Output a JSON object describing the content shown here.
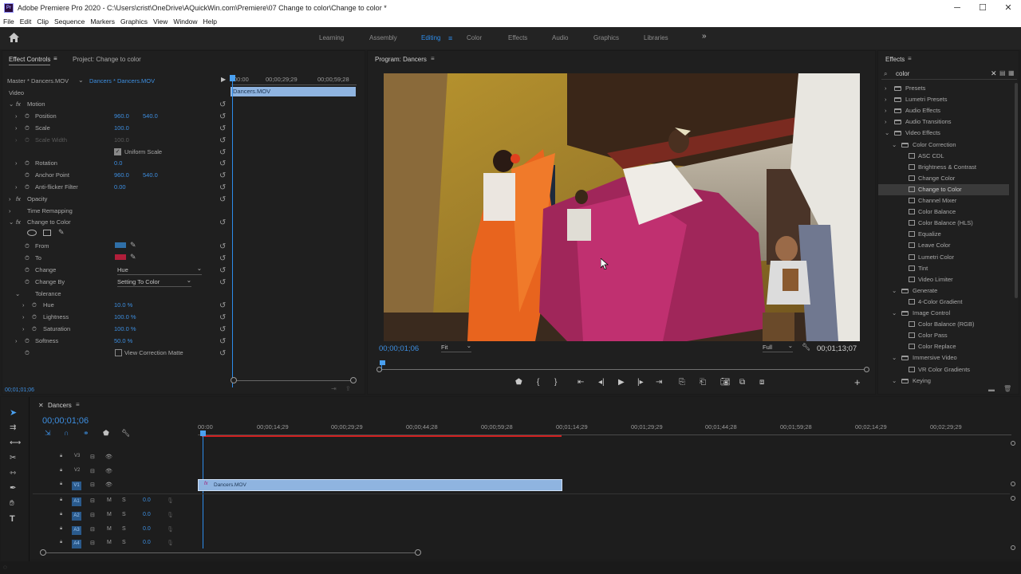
{
  "app": {
    "title": "Adobe Premiere Pro 2020 - C:\\Users\\crist\\OneDrive\\AQuickWin.com\\Premiere\\07 Change to color\\Change to color *"
  },
  "menu": [
    "File",
    "Edit",
    "Clip",
    "Sequence",
    "Markers",
    "Graphics",
    "View",
    "Window",
    "Help"
  ],
  "workspaces": [
    {
      "label": "Learning"
    },
    {
      "label": "Assembly"
    },
    {
      "label": "Editing",
      "active": true
    },
    {
      "label": "Color"
    },
    {
      "label": "Effects"
    },
    {
      "label": "Audio"
    },
    {
      "label": "Graphics"
    },
    {
      "label": "Libraries"
    }
  ],
  "effect_controls": {
    "tab_label": "Effect Controls",
    "project_tab": "Project: Change to color",
    "master": "Master * Dancers.MOV",
    "clip": "Dancers * Dancers.MOV",
    "ruler": [
      "00:00",
      "00;00;29;29",
      "00;00;59;28"
    ],
    "clip_bar": "Dancers.MOV",
    "timecode": "00;01;01;06",
    "video_label": "Video",
    "motion": "Motion",
    "position": {
      "label": "Position",
      "x": "960.0",
      "y": "540.0"
    },
    "scale": {
      "label": "Scale",
      "value": "100.0"
    },
    "scale_width": {
      "label": "Scale Width",
      "value": "100.0"
    },
    "uniform_scale": "Uniform Scale",
    "rotation": {
      "label": "Rotation",
      "value": "0.0"
    },
    "anchor": {
      "label": "Anchor Point",
      "x": "960.0",
      "y": "540.0"
    },
    "antiflicker": {
      "label": "Anti-flicker Filter",
      "value": "0.00"
    },
    "opacity": "Opacity",
    "time_remap": "Time Remapping",
    "change_to_color": "Change to Color",
    "from": "From",
    "to": "To",
    "change": {
      "label": "Change",
      "value": "Hue"
    },
    "change_by": {
      "label": "Change By",
      "value": "Setting To Color"
    },
    "tolerance": "Tolerance",
    "hue": {
      "label": "Hue",
      "value": "10.0 %"
    },
    "lightness": {
      "label": "Lightness",
      "value": "100.0 %"
    },
    "saturation": {
      "label": "Saturation",
      "value": "100.0 %"
    },
    "softness": {
      "label": "Softness",
      "value": "50.0 %"
    },
    "view_matte": "View Correction Matte",
    "from_color": "#2f6fa8",
    "to_color": "#b01e3a"
  },
  "program": {
    "title": "Program: Dancers",
    "timecode": "00;00;01;06",
    "fit": "Fit",
    "quality": "Full",
    "duration": "00;01;13;07"
  },
  "effects": {
    "title": "Effects",
    "search": "color",
    "items": [
      {
        "label": "Presets",
        "level": 0,
        "type": "folder"
      },
      {
        "label": "Lumetri Presets",
        "level": 0,
        "type": "folder"
      },
      {
        "label": "Audio Effects",
        "level": 0,
        "type": "folder"
      },
      {
        "label": "Audio Transitions",
        "level": 0,
        "type": "folder"
      },
      {
        "label": "Video Effects",
        "level": 0,
        "type": "folder",
        "open": true
      },
      {
        "label": "Color Correction",
        "level": 1,
        "type": "folder",
        "open": true
      },
      {
        "label": "ASC CDL",
        "level": 2,
        "type": "fx"
      },
      {
        "label": "Brightness & Contrast",
        "level": 2,
        "type": "fx"
      },
      {
        "label": "Change Color",
        "level": 2,
        "type": "fx"
      },
      {
        "label": "Change to Color",
        "level": 2,
        "type": "fx",
        "selected": true
      },
      {
        "label": "Channel Mixer",
        "level": 2,
        "type": "fx"
      },
      {
        "label": "Color Balance",
        "level": 2,
        "type": "fx"
      },
      {
        "label": "Color Balance (HLS)",
        "level": 2,
        "type": "fx"
      },
      {
        "label": "Equalize",
        "level": 2,
        "type": "fx"
      },
      {
        "label": "Leave Color",
        "level": 2,
        "type": "fx"
      },
      {
        "label": "Lumetri Color",
        "level": 2,
        "type": "fx"
      },
      {
        "label": "Tint",
        "level": 2,
        "type": "fx"
      },
      {
        "label": "Video Limiter",
        "level": 2,
        "type": "fx"
      },
      {
        "label": "Generate",
        "level": 1,
        "type": "folder",
        "open": true
      },
      {
        "label": "4-Color Gradient",
        "level": 2,
        "type": "fx"
      },
      {
        "label": "Image Control",
        "level": 1,
        "type": "folder",
        "open": true
      },
      {
        "label": "Color Balance (RGB)",
        "level": 2,
        "type": "fx"
      },
      {
        "label": "Color Pass",
        "level": 2,
        "type": "fx"
      },
      {
        "label": "Color Replace",
        "level": 2,
        "type": "fx"
      },
      {
        "label": "Immersive Video",
        "level": 1,
        "type": "folder",
        "open": true
      },
      {
        "label": "VR Color Gradients",
        "level": 2,
        "type": "fx"
      },
      {
        "label": "Keying",
        "level": 1,
        "type": "folder",
        "open": true
      }
    ]
  },
  "timeline": {
    "tab": "Dancers",
    "timecode": "00;00;01;06",
    "ruler": [
      "00:00",
      "00;00;14;29",
      "00;00;29;29",
      "00;00;44;28",
      "00;00;59;28",
      "00;01;14;29",
      "00;01;29;29",
      "00;01;44;28",
      "00;01;59;28",
      "00;02;14;29",
      "00;02;29;29"
    ],
    "video_tracks": [
      "V3",
      "V2",
      "V1"
    ],
    "audio_tracks": [
      {
        "name": "A1",
        "vol": "0.0"
      },
      {
        "name": "A2",
        "vol": "0.0"
      },
      {
        "name": "A3",
        "vol": "0.0"
      },
      {
        "name": "A4",
        "vol": "0.0"
      }
    ],
    "clip": "Dancers.MOV",
    "m": "M",
    "s": "S"
  }
}
